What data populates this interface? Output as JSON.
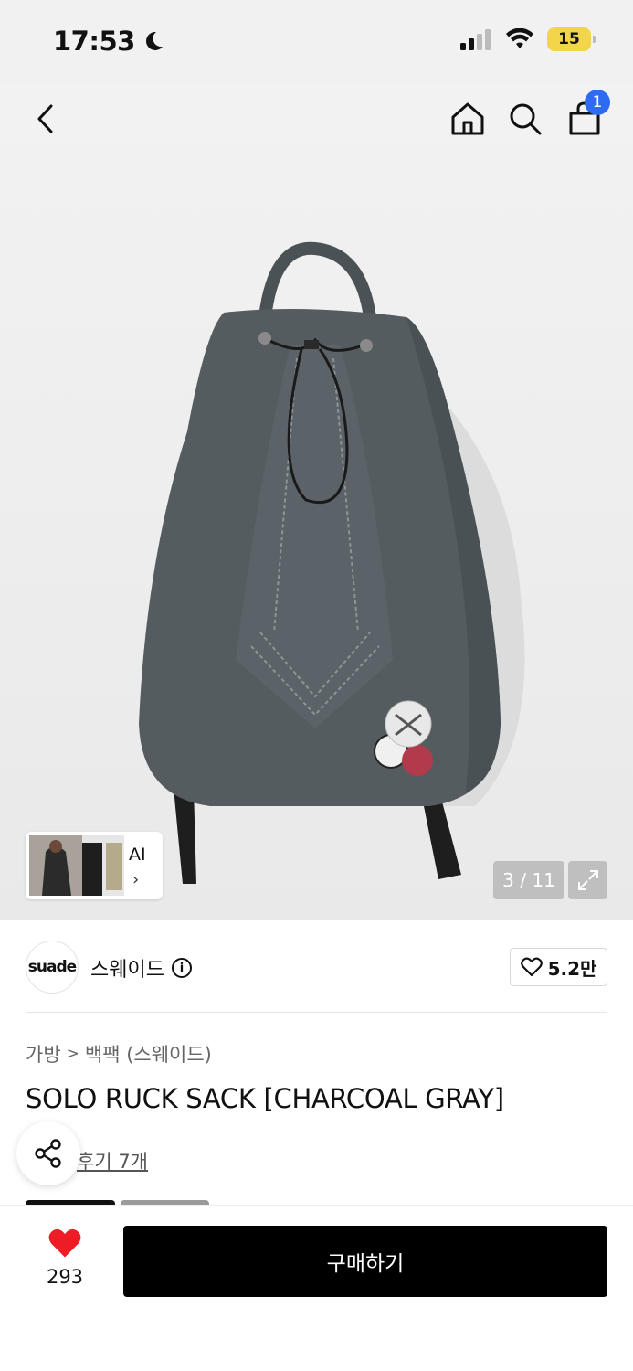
{
  "status_bar": {
    "time": "17:53",
    "battery": "15"
  },
  "header": {
    "cart_count": "1"
  },
  "gallery": {
    "ai_label": "AI",
    "counter": "3 / 11"
  },
  "brand": {
    "logo_text": "suade",
    "name": "스웨이드",
    "likes": "5.2만"
  },
  "breadcrumb": {
    "category": "가방",
    "separator": ">",
    "subcategory": "백팩 (스웨이드)"
  },
  "product": {
    "title": "SOLO RUCK SACK [CHARCOAL GRAY]",
    "reviews": "후기 7개"
  },
  "bottom_bar": {
    "wish_count": "293",
    "buy_label": "구매하기"
  },
  "colors": {
    "accent": "#2c6bf2",
    "heart": "#ee1c25",
    "battery": "#f2d54a",
    "bag": "#555c60"
  }
}
